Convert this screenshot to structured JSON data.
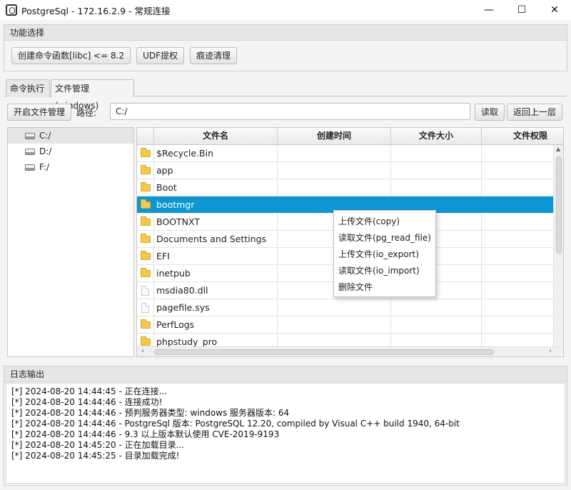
{
  "window": {
    "title": "PostgreSql - 172.16.2.9 - 常规连接",
    "minimize_glyph": "—",
    "maximize_glyph": "☐",
    "close_glyph": "✕"
  },
  "function_panel": {
    "title": "功能选择",
    "buttons": [
      "创建命令函数[libc] <= 8.2",
      "UDF提权",
      "痕迹清理"
    ]
  },
  "tabs": [
    {
      "label": "命令执行",
      "active": false
    },
    {
      "label": "文件管理(windows)",
      "active": true
    }
  ],
  "toolbar": {
    "open_button": "开启文件管理",
    "path_label": "路径:",
    "path_value": "C:/",
    "read_button": "读取",
    "back_button": "返回上一层"
  },
  "tree": {
    "items": [
      "C:/",
      "D:/",
      "F:/"
    ],
    "selected_index": 0
  },
  "file_table": {
    "columns": [
      "文件名",
      "创建时间",
      "文件大小",
      "文件权限"
    ],
    "rows": [
      {
        "name": "$Recycle.Bin",
        "type": "folder"
      },
      {
        "name": "app",
        "type": "folder"
      },
      {
        "name": "Boot",
        "type": "folder"
      },
      {
        "name": "bootmgr",
        "type": "folder",
        "selected": true
      },
      {
        "name": "BOOTNXT",
        "type": "folder"
      },
      {
        "name": "Documents and Settings",
        "type": "folder"
      },
      {
        "name": "EFI",
        "type": "folder"
      },
      {
        "name": "inetpub",
        "type": "folder"
      },
      {
        "name": "msdia80.dll",
        "type": "file"
      },
      {
        "name": "pagefile.sys",
        "type": "file"
      },
      {
        "name": "PerfLogs",
        "type": "folder"
      },
      {
        "name": "phpstudy_pro",
        "type": "folder"
      }
    ]
  },
  "context_menu": {
    "items": [
      "上传文件(copy)",
      "读取文件(pg_read_file)",
      "上传文件(io_export)",
      "读取文件(io_import)",
      "删除文件"
    ]
  },
  "log": {
    "title": "日志输出",
    "lines": [
      "[*] 2024-08-20 14:44:45 - 正在连接...",
      "[*] 2024-08-20 14:44:46 - 连接成功!",
      "[*] 2024-08-20 14:44:46 - 预判服务器类型: windows 服务器版本: 64",
      "[*] 2024-08-20 14:44:46 - PostgreSql 版本: PostgreSQL 12.20, compiled by Visual C++ build 1940, 64-bit",
      "[*] 2024-08-20 14:44:46 - 9.3 以上版本默认使用 CVE-2019-9193",
      "[*] 2024-08-20 14:45:20 - 正在加载目录...",
      "[*] 2024-08-20 14:45:25 - 目录加载完成!"
    ]
  },
  "colors": {
    "selection": "#0d96d2",
    "folder": "#f2c94c"
  }
}
